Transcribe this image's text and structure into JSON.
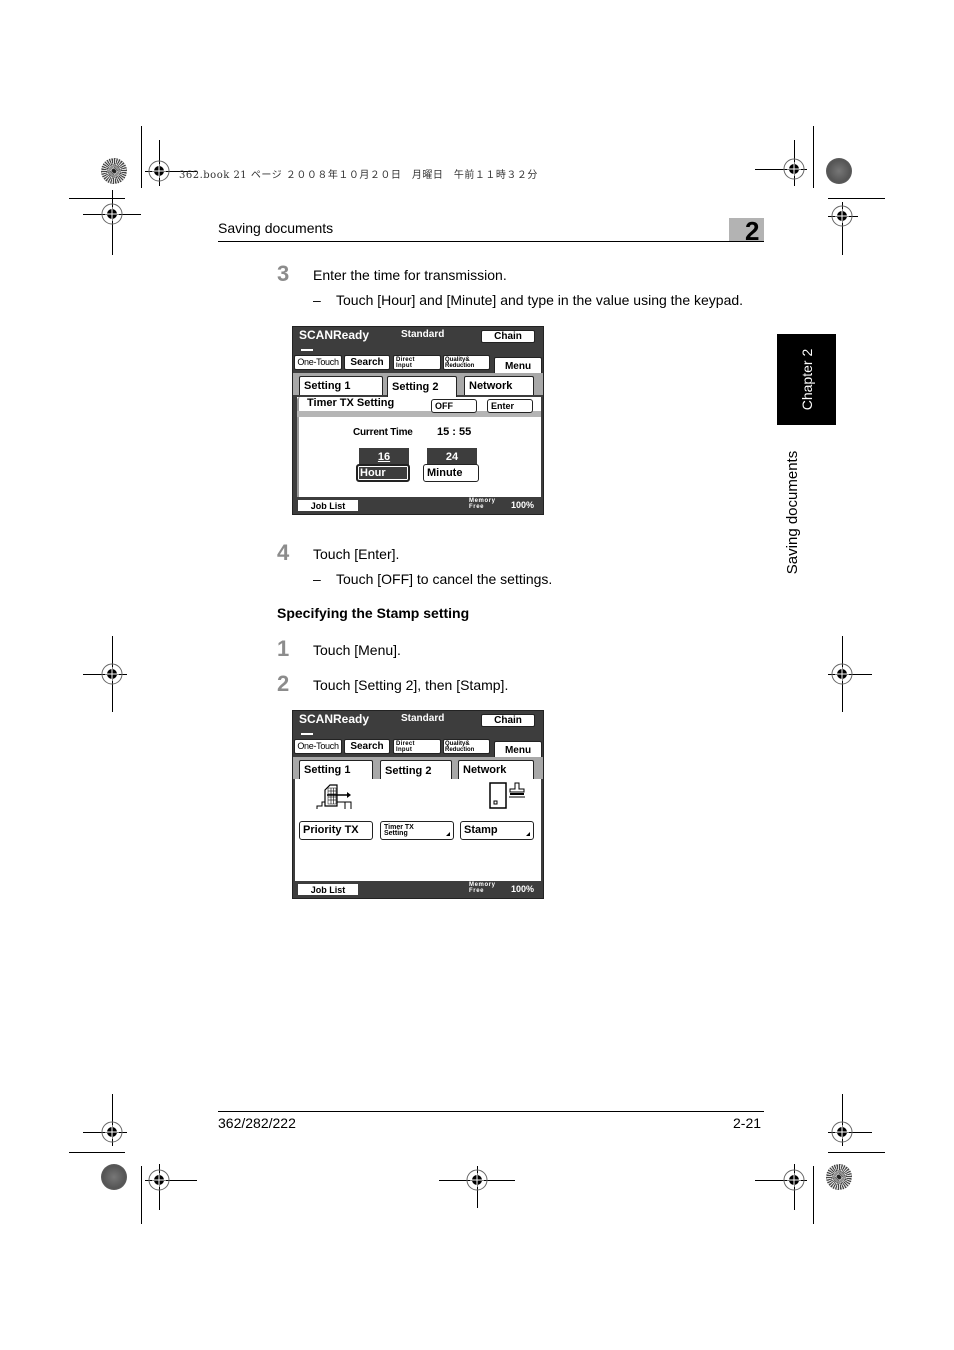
{
  "print_meta": {
    "header_line": "362.book  21 ページ  ２００８年１０月２０日　月曜日　午前１１時３２分"
  },
  "running_head": {
    "title": "Saving documents",
    "chapter_number": "2"
  },
  "side_tab": {
    "chapter_label": "Chapter 2",
    "section_label": "Saving documents"
  },
  "steps_part1": [
    {
      "number": "3",
      "text": "Enter the time for transmission.",
      "sub": "Touch [Hour] and [Minute] and type in the value using the keypad."
    },
    {
      "number": "4",
      "text": "Touch [Enter].",
      "sub": "Touch [OFF] to cancel the settings."
    }
  ],
  "section": {
    "title": "Specifying the Stamp setting"
  },
  "steps_part2": [
    {
      "number": "1",
      "text": "Touch [Menu]."
    },
    {
      "number": "2",
      "text": "Touch [Setting 2], then [Stamp]."
    }
  ],
  "sub_dash": "–",
  "panel_common": {
    "status": "SCANReady",
    "mode": "Standard",
    "chain": "Chain",
    "one_touch": "One-Touch",
    "search": "Search",
    "direct_input_l1": "Direct",
    "direct_input_l2": "Input",
    "quality_l1": "Quality&",
    "quality_l2": "Reduction",
    "menu": "Menu",
    "tabs": [
      "Setting 1",
      "Setting 2",
      "Network"
    ],
    "active_tab": "Setting 2",
    "job_list": "Job List",
    "memory_l1": "Memory",
    "memory_l2": "Free",
    "memory_pct": "100%"
  },
  "panel_timer": {
    "header": "Timer TX Setting",
    "off": "OFF",
    "enter": "Enter",
    "current_time_label": "Current Time",
    "current_time_value": "15 : 55",
    "hour_value": "16",
    "minute_value": "24",
    "hour_button": "Hour",
    "minute_button": "Minute"
  },
  "panel_setting2": {
    "buttons": [
      {
        "label": "Priority TX",
        "icon": "priority-tx-icon"
      },
      {
        "label_l1": "Timer TX",
        "label_l2": "Setting"
      },
      {
        "label": "Stamp",
        "icon": "stamp-icon"
      }
    ]
  },
  "footer": {
    "model": "362/282/222",
    "page": "2-21"
  }
}
